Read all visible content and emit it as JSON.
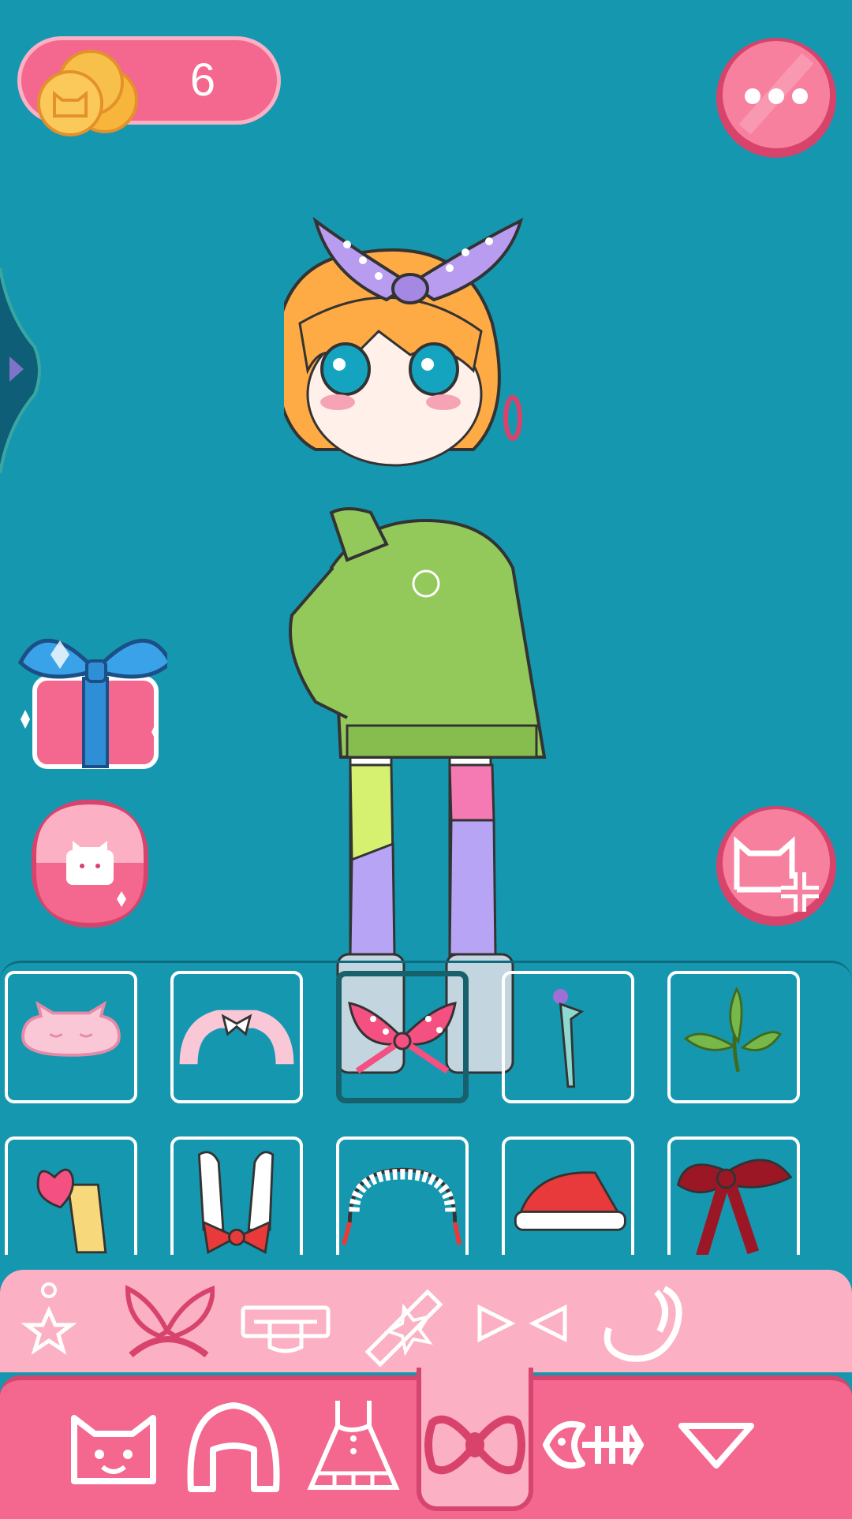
{
  "coins": {
    "count": "6",
    "icon": "cat-coin-icon"
  },
  "buttons": {
    "more": "more-options-icon",
    "drawer": "chevron-right-icon",
    "gift": "gift-box-icon",
    "gacha": "cat-capsule-icon",
    "share": "cat-add-icon"
  },
  "items": {
    "selected_index": 2,
    "rows": [
      [
        "cat-sleep-mask",
        "pink-fluffy-headband",
        "polka-dot-ribbon",
        "ribbon-hairpin",
        "leaf-sprig"
      ],
      [
        "heart-hair-clip",
        "bunny-ears-bow",
        "maid-headband",
        "santa-hat",
        "red-bow"
      ]
    ]
  },
  "subcategories": {
    "selected_index": 1,
    "icons": [
      "flower-icon",
      "bow-icon",
      "hat-icon",
      "hairclip-icon",
      "earring-icon",
      "ear-hook-icon"
    ]
  },
  "tabs": {
    "selected_index": 3,
    "icons": [
      "cat-face-icon",
      "hair-icon",
      "dress-icon",
      "bow-tie-icon",
      "fishbone-icon",
      "triangle-down-icon"
    ]
  },
  "colors": {
    "background": "#1697b0",
    "accent_pink": "#f4678f",
    "light_pink": "#fcb0c3",
    "selected_border": "#17616d"
  }
}
